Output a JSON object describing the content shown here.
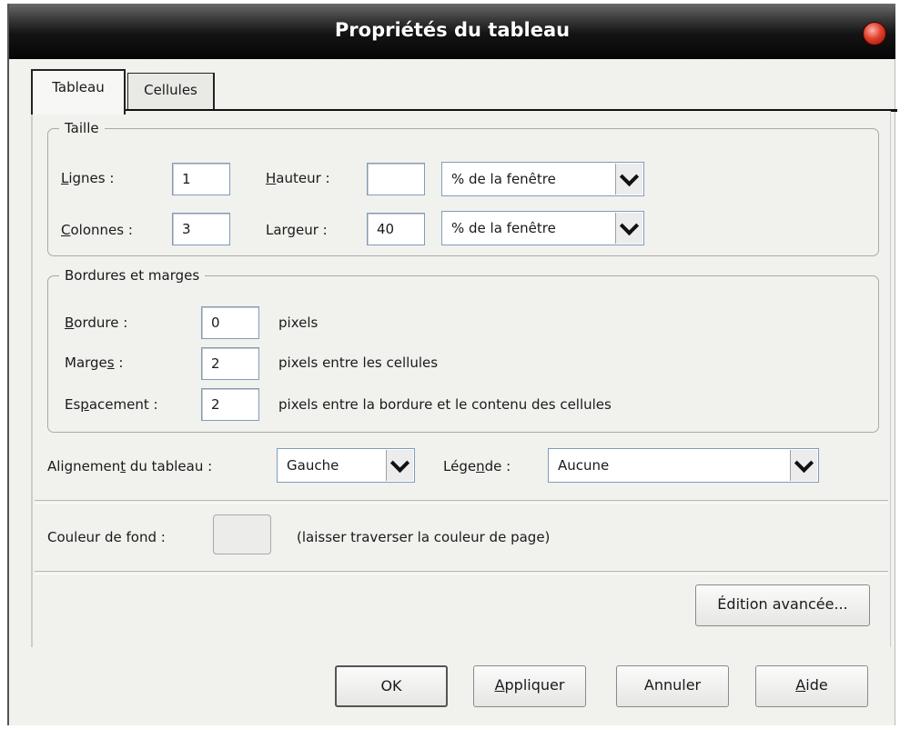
{
  "dialog": {
    "title": "Propriétés du tableau"
  },
  "tabs": [
    {
      "label": "Tableau",
      "active": true
    },
    {
      "label": "Cellules",
      "active": false
    }
  ],
  "size_group": {
    "legend": "Taille",
    "rows": {
      "label": "Lignes :",
      "value": "1"
    },
    "columns": {
      "label": "Colonnes :",
      "value": "3"
    },
    "height": {
      "label": "Hauteur :",
      "value": "",
      "unit": "% de la fenêtre"
    },
    "width": {
      "label": "Largeur :",
      "value": "40",
      "unit": "% de la fenêtre"
    }
  },
  "borders_group": {
    "legend": "Bordures et marges",
    "border": {
      "label": "Bordure :",
      "value": "0",
      "suffix": "pixels"
    },
    "padding": {
      "label": "Marges :",
      "value": "2",
      "suffix": "pixels entre les cellules"
    },
    "spacing": {
      "label": "Espacement :",
      "value": "2",
      "suffix": "pixels entre la bordure et le contenu des cellules"
    }
  },
  "alignment": {
    "label": "Alignement du tableau :",
    "value": "Gauche"
  },
  "caption": {
    "label": "Légende :",
    "value": "Aucune"
  },
  "background": {
    "label": "Couleur de fond :",
    "note": "(laisser traverser la couleur de page)"
  },
  "buttons": {
    "advanced": "Édition avancée...",
    "ok": "OK",
    "apply": "Appliquer",
    "cancel": "Annuler",
    "help": "Aide"
  },
  "icons": {
    "close": "close-icon",
    "dropdown": "chevron-down-icon"
  }
}
